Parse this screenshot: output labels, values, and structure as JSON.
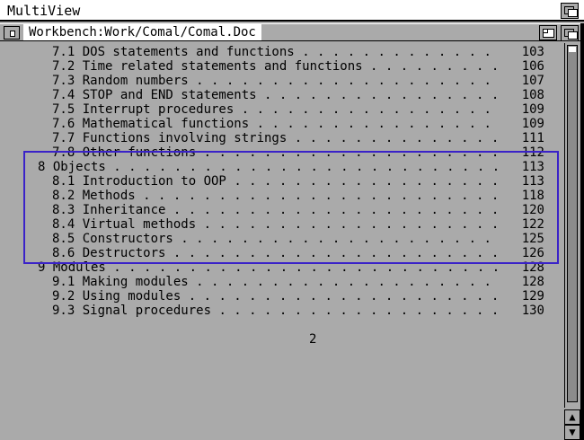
{
  "screen": {
    "title": "MultiView"
  },
  "window": {
    "title": "Workbench:Work/Comal/Comal.Doc"
  },
  "toc": [
    {
      "num": "7.1",
      "title": "DOS statements and functions",
      "page": "103",
      "level": 2
    },
    {
      "num": "7.2",
      "title": "Time related statements and functions",
      "page": "106",
      "level": 2
    },
    {
      "num": "7.3",
      "title": "Random numbers",
      "page": "107",
      "level": 2
    },
    {
      "num": "7.4",
      "title": "STOP and END statements",
      "page": "108",
      "level": 2
    },
    {
      "num": "7.5",
      "title": "Interrupt procedures",
      "page": "109",
      "level": 2
    },
    {
      "num": "7.6",
      "title": "Mathematical functions",
      "page": "109",
      "level": 2
    },
    {
      "num": "7.7",
      "title": "Functions involving strings",
      "page": "111",
      "level": 2
    },
    {
      "num": "7.8",
      "title": "Other functions",
      "page": "112",
      "level": 2
    },
    {
      "num": "8",
      "title": "Objects",
      "page": "113",
      "level": 1
    },
    {
      "num": "8.1",
      "title": "Introduction to OOP",
      "page": "113",
      "level": 2
    },
    {
      "num": "8.2",
      "title": "Methods",
      "page": "118",
      "level": 2
    },
    {
      "num": "8.3",
      "title": "Inheritance",
      "page": "120",
      "level": 2
    },
    {
      "num": "8.4",
      "title": "Virtual methods",
      "page": "122",
      "level": 2
    },
    {
      "num": "8.5",
      "title": "Constructors",
      "page": "125",
      "level": 2
    },
    {
      "num": "8.6",
      "title": "Destructors",
      "page": "126",
      "level": 2
    },
    {
      "num": "9",
      "title": "Modules",
      "page": "128",
      "level": 1
    },
    {
      "num": "9.1",
      "title": "Making modules",
      "page": "128",
      "level": 2
    },
    {
      "num": "9.2",
      "title": "Using modules",
      "page": "129",
      "level": 2
    },
    {
      "num": "9.3",
      "title": "Signal procedures",
      "page": "130",
      "level": 2
    }
  ],
  "page_number": "2",
  "colors": {
    "highlight": "#3a22c8",
    "background": "#aaaaaa"
  },
  "icons": {
    "up": "up-arrow-icon",
    "down": "down-arrow-icon"
  }
}
